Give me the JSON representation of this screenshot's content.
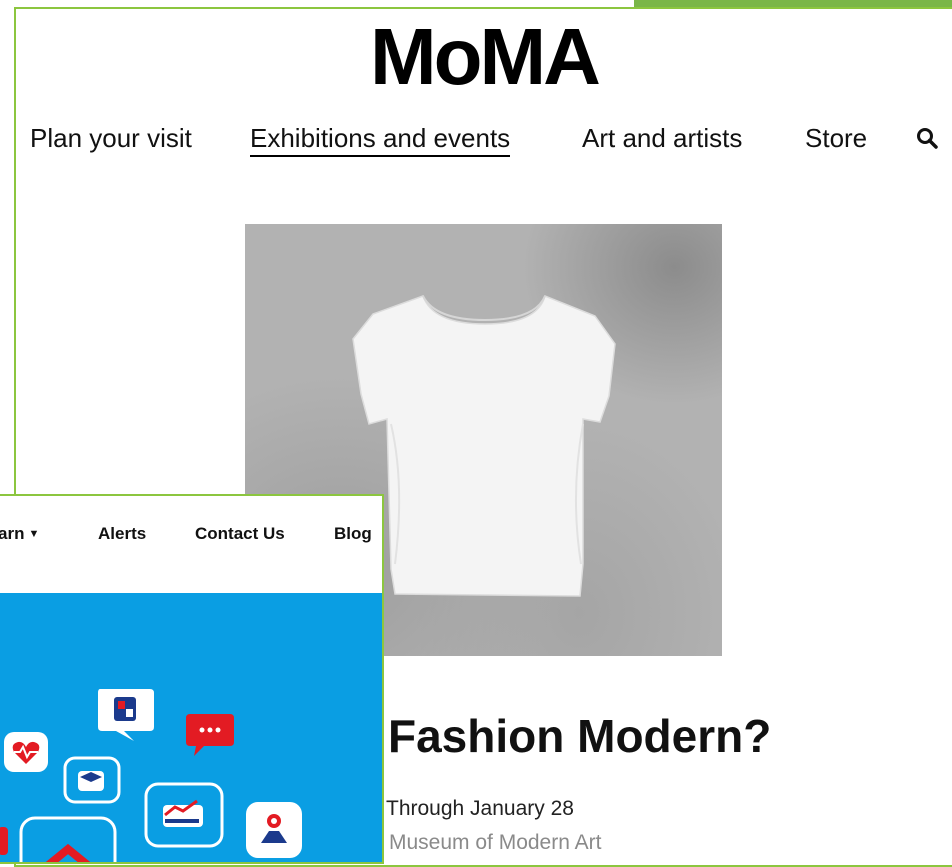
{
  "moma": {
    "logo": "MoMA",
    "nav": [
      {
        "label": "Plan your visit",
        "active": false
      },
      {
        "label": "Exhibitions and events",
        "active": true
      },
      {
        "label": "Art and artists",
        "active": false
      },
      {
        "label": "Store",
        "active": false
      }
    ],
    "search_icon": "search-icon",
    "hero_image": "white-tshirt-on-concrete",
    "event": {
      "title": "Fashion Modern?",
      "date": "Through January 28",
      "venue": "Museum of Modern Art"
    }
  },
  "site2": {
    "nav": [
      {
        "label": "arn",
        "dropdown": true
      },
      {
        "label": "Alerts",
        "dropdown": false
      },
      {
        "label": "Contact Us",
        "dropdown": false
      },
      {
        "label": "Blog",
        "dropdown": false
      }
    ],
    "hero_icons": [
      "heart-icon",
      "abc-block-icon",
      "chat-dots-icon",
      "graduation-cap-icon",
      "chart-up-icon",
      "map-pin-icon",
      "home-icon"
    ],
    "colors": {
      "hero_bg": "#0a9ee3",
      "accent_red": "#e31b23",
      "border_green": "#8cc63f"
    }
  }
}
